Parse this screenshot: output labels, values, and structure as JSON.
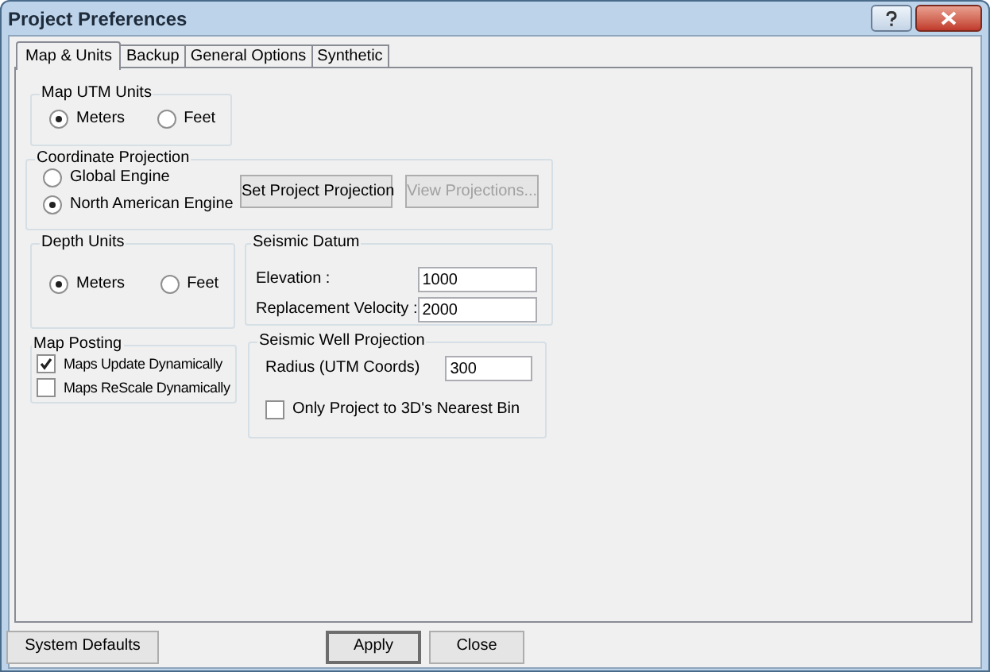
{
  "window": {
    "title": "Project Preferences"
  },
  "tabs": [
    {
      "label": "Map & Units",
      "selected": true
    },
    {
      "label": "Backup",
      "selected": false
    },
    {
      "label": "General Options",
      "selected": false
    },
    {
      "label": "Synthetic",
      "selected": false
    }
  ],
  "map_utm_units": {
    "title": "Map UTM Units",
    "options": [
      {
        "label": "Meters",
        "selected": true
      },
      {
        "label": "Feet",
        "selected": false
      }
    ]
  },
  "coordinate_projection": {
    "title": "Coordinate Projection",
    "options": [
      {
        "label": "Global Engine",
        "selected": false
      },
      {
        "label": "North American Engine",
        "selected": true
      }
    ],
    "buttons": [
      {
        "label": "Set Project Projection",
        "disabled": false
      },
      {
        "label": "View Projections...",
        "disabled": true
      }
    ]
  },
  "depth_units": {
    "title": "Depth Units",
    "options": [
      {
        "label": "Meters",
        "selected": true
      },
      {
        "label": "Feet",
        "selected": false
      }
    ]
  },
  "seismic_datum": {
    "title": "Seismic Datum",
    "fields": [
      {
        "label": "Elevation :",
        "value": "1000"
      },
      {
        "label": "Replacement Velocity :",
        "value": "2000"
      }
    ]
  },
  "map_posting": {
    "title": "Map Posting",
    "checkboxes": [
      {
        "label": "Maps Update Dynamically",
        "checked": true
      },
      {
        "label": "Maps ReScale Dynamically",
        "checked": false
      }
    ]
  },
  "seismic_well_projection": {
    "title": "Seismic Well Projection",
    "fields": [
      {
        "label": "Radius (UTM Coords)",
        "value": "300"
      }
    ],
    "checkboxes": [
      {
        "label": "Only Project to 3D's Nearest Bin",
        "checked": false
      }
    ]
  },
  "footer_buttons": [
    {
      "label": "System Defaults",
      "default": false
    },
    {
      "label": "Apply",
      "default": true
    },
    {
      "label": "Close",
      "default": false
    }
  ]
}
